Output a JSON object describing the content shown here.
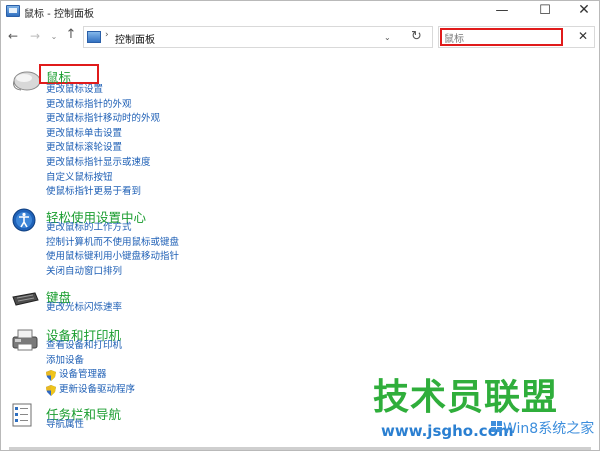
{
  "window": {
    "title": "鼠标 - 控制面板"
  },
  "controls": {
    "minimize": "—",
    "maximize": "☐",
    "close": "✕"
  },
  "navigation": {
    "back": "←",
    "forward": "→",
    "history": "⌄",
    "up": "↑",
    "address_path": "控制面板",
    "address_separator": "›",
    "refresh": "↻"
  },
  "search": {
    "value": "鼠标",
    "clear": "✕"
  },
  "categories": [
    {
      "title": "鼠标",
      "icon": "mouse-icon",
      "links": [
        "更改鼠标设置",
        "更改鼠标指针的外观",
        "更改鼠标指针移动时的外观",
        "更改鼠标单击设置",
        "更改鼠标滚轮设置",
        "更改鼠标指针显示或速度",
        "自定义鼠标按钮",
        "使鼠标指针更易于看到"
      ]
    },
    {
      "title": "轻松使用设置中心",
      "icon": "ease-of-access-icon",
      "links": [
        "更改鼠标的工作方式",
        "控制计算机而不使用鼠标或键盘",
        "使用鼠标键利用小键盘移动指针",
        "关闭自动窗口排列"
      ]
    },
    {
      "title": "键盘",
      "icon": "keyboard-icon",
      "links": [
        "更改光标闪烁速率"
      ]
    },
    {
      "title": "设备和打印机",
      "icon": "printer-icon",
      "links": [
        "查看设备和打印机",
        "添加设备",
        "设备管理器",
        "更新设备驱动程序"
      ]
    },
    {
      "title": "任务栏和导航",
      "icon": "taskbar-icon",
      "links": [
        "导航属性"
      ]
    }
  ],
  "watermark": {
    "text": "技术员联盟",
    "url": "www.jsgho.com",
    "sub": "Win8系统之家"
  },
  "colors": {
    "title_green": "#1a9d2f",
    "link_blue": "#1e5fb5",
    "highlight_red": "#e01b1b",
    "watermark_green": "#2fae3b"
  }
}
